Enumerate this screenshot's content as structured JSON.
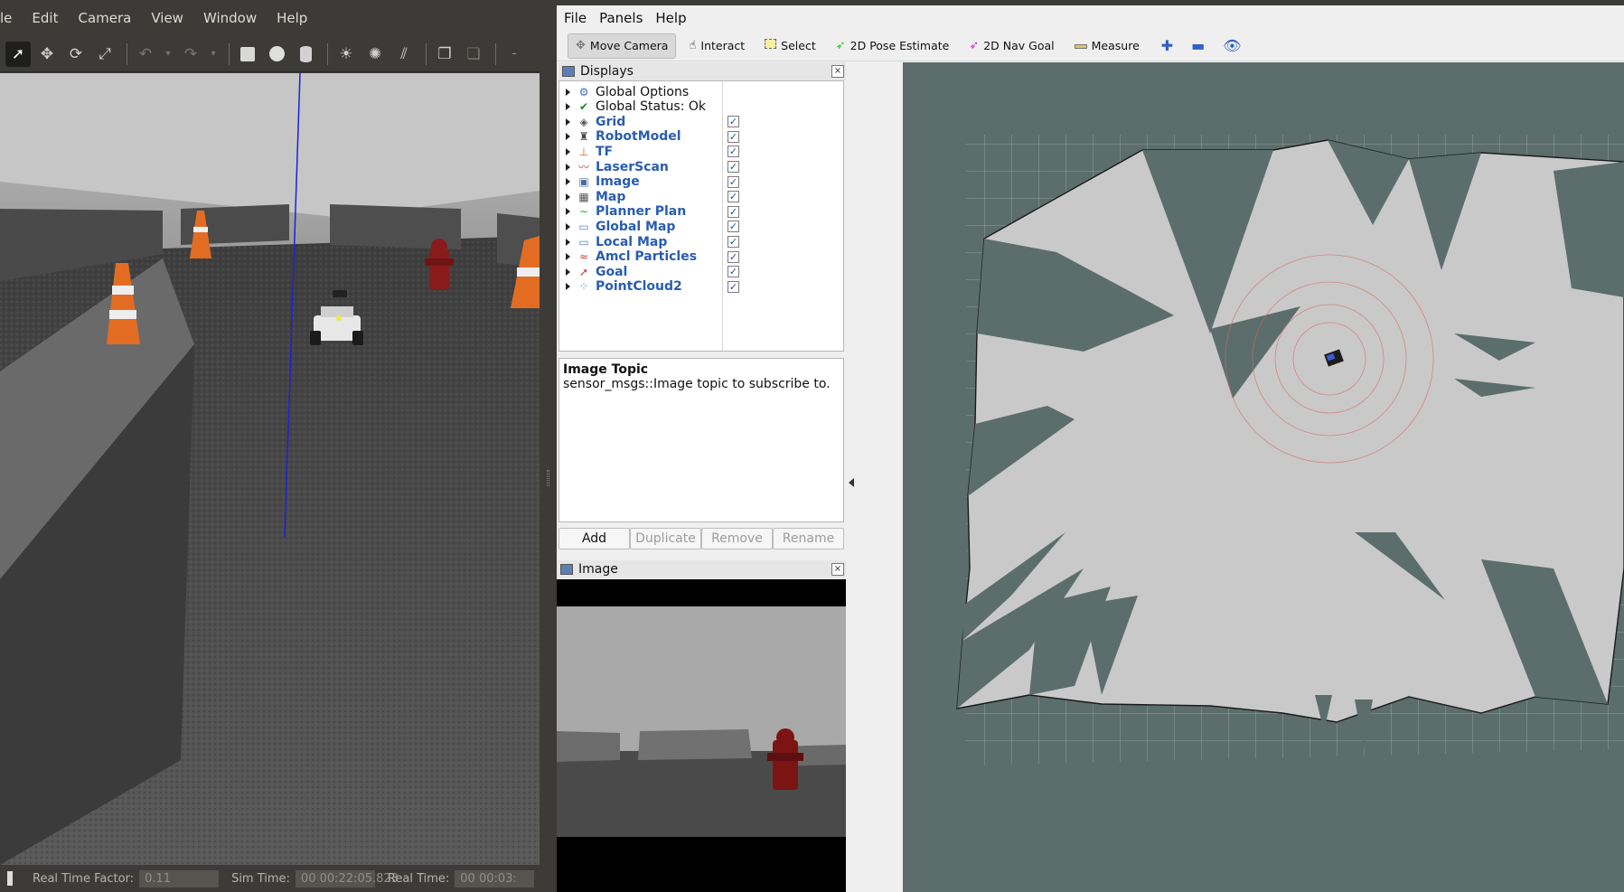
{
  "gazebo": {
    "menu": [
      "le",
      "Edit",
      "Camera",
      "View",
      "Window",
      "Help"
    ],
    "tool_icons": [
      "select-arrow",
      "translate",
      "rotate",
      "scale",
      "undo",
      "redo",
      "box",
      "sphere",
      "cylinder",
      "sun-light",
      "point-light",
      "directional-light",
      "copy",
      "paste"
    ],
    "status": {
      "rtf_label": "Real Time Factor:",
      "rtf_value": "0.11",
      "sim_label": "Sim Time:",
      "sim_value": "00 00:22:05.823",
      "real_label": "Real Time:",
      "real_value": "00 00:03:"
    }
  },
  "rviz": {
    "menu": [
      "File",
      "Panels",
      "Help"
    ],
    "tools": [
      "Move Camera",
      "Interact",
      "Select",
      "2D Pose Estimate",
      "2D Nav Goal",
      "Measure"
    ],
    "displays": {
      "title": "Displays",
      "close": "×",
      "items": [
        {
          "label": "Global Options",
          "icon": "gear-icon",
          "checked": null,
          "plain": true
        },
        {
          "label": "Global Status: Ok",
          "icon": "check-icon",
          "checked": null,
          "plain": true
        },
        {
          "label": "Grid",
          "icon": "grid-icon",
          "checked": true
        },
        {
          "label": "RobotModel",
          "icon": "robot-icon",
          "checked": true
        },
        {
          "label": "TF",
          "icon": "axes-icon",
          "checked": true
        },
        {
          "label": "LaserScan",
          "icon": "laser-icon",
          "checked": true
        },
        {
          "label": "Image",
          "icon": "image-icon",
          "checked": true
        },
        {
          "label": "Map",
          "icon": "map-icon",
          "checked": true
        },
        {
          "label": "Planner Plan",
          "icon": "path-icon",
          "checked": true
        },
        {
          "label": "Global Map",
          "icon": "folder-icon",
          "checked": true
        },
        {
          "label": "Local Map",
          "icon": "folder-icon",
          "checked": true
        },
        {
          "label": "Amcl Particles",
          "icon": "particles-icon",
          "checked": true
        },
        {
          "label": "Goal",
          "icon": "arrow-icon",
          "checked": true
        },
        {
          "label": "PointCloud2",
          "icon": "cloud-icon",
          "checked": true
        }
      ],
      "check_mark": "✓",
      "help_title": "Image Topic",
      "help_text": "sensor_msgs::Image topic to subscribe to.",
      "buttons": {
        "add": "Add",
        "duplicate": "Duplicate",
        "remove": "Remove",
        "rename": "Rename"
      }
    },
    "image_panel": {
      "title": "Image",
      "close": "×"
    }
  }
}
